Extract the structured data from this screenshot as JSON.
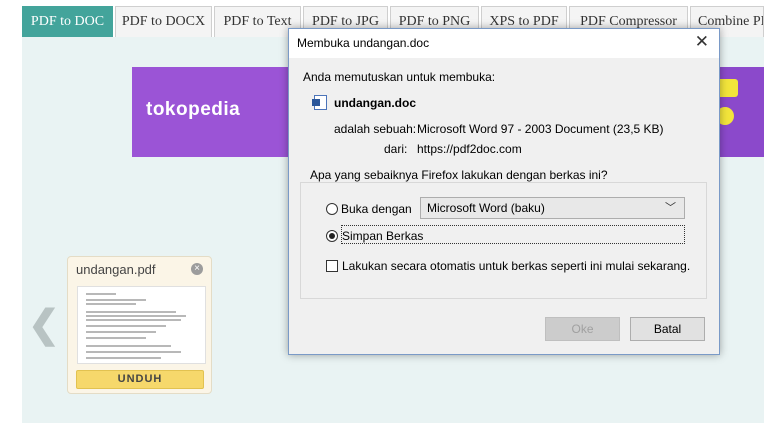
{
  "tabs": [
    {
      "label": "PDF to DOC",
      "active": true
    },
    {
      "label": "PDF to DOCX"
    },
    {
      "label": "PDF to Text"
    },
    {
      "label": "PDF to JPG"
    },
    {
      "label": "PDF to PNG"
    },
    {
      "label": "XPS to PDF"
    },
    {
      "label": "PDF Compressor"
    },
    {
      "label": "Combine PDF"
    }
  ],
  "banner": {
    "brand": "tokopedia"
  },
  "file_card": {
    "filename": "undangan.pdf",
    "download_label": "UNDUH",
    "close_icon": "×"
  },
  "nav": {
    "prev_icon": "❮"
  },
  "dialog": {
    "title": "Membuka undangan.doc",
    "close_icon": "✕",
    "intro": "Anda memutuskan untuk membuka:",
    "filename": "undangan.doc",
    "type_label": "adalah sebuah:",
    "type_value": "Microsoft Word 97 - 2003 Document (23,5 KB)",
    "from_label": "dari:",
    "from_value": "https://pdf2doc.com",
    "question": "Apa yang sebaiknya Firefox lakukan dengan berkas ini?",
    "open_with_label": "Buka dengan",
    "open_with_value": "Microsoft Word (baku)",
    "save_label": "Simpan Berkas",
    "auto_label": "Lakukan secara otomatis untuk berkas seperti ini mulai sekarang.",
    "ok_label": "Oke",
    "cancel_label": "Batal"
  },
  "colors": {
    "active_tab": "#43a49b",
    "banner": "#8b49cb",
    "download_button": "#f6d86b"
  }
}
